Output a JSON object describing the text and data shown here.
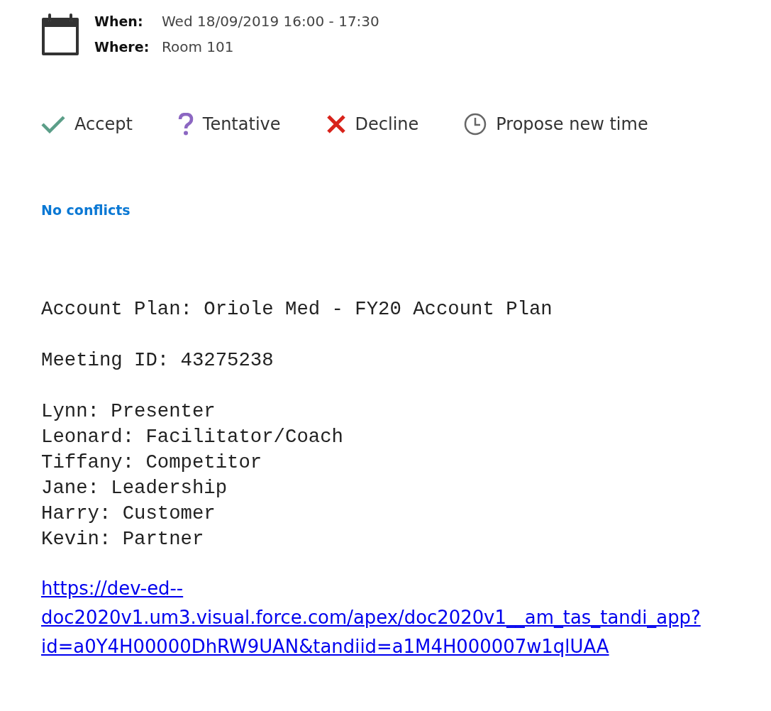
{
  "meeting": {
    "when_label": "When:",
    "when_value": "Wed 18/09/2019 16:00 - 17:30",
    "where_label": "Where:",
    "where_value": "Room 101"
  },
  "responses": [
    {
      "kind": "accept",
      "label": "Accept"
    },
    {
      "kind": "tentative",
      "label": "Tentative"
    },
    {
      "kind": "decline",
      "label": "Decline"
    },
    {
      "kind": "propose",
      "label": "Propose new time"
    }
  ],
  "conflicts": "No conflicts",
  "body": {
    "title": "Account Plan: Oriole Med - FY20 Account Plan",
    "meeting_id": "Meeting ID: 43275238",
    "roles": [
      "Lynn: Presenter",
      "Leonard: Facilitator/Coach",
      "Tiffany: Competitor",
      "Jane: Leadership",
      "Harry: Customer",
      "Kevin: Partner"
    ],
    "link_lines": [
      "https://dev-ed--",
      "doc2020v1.um3.visual.force.com/apex/doc2020v1__am_tas_tandi_app?",
      "id=a0Y4H00000DhRW9UAN&tandiid=a1M4H000007w1qlUAA"
    ]
  }
}
